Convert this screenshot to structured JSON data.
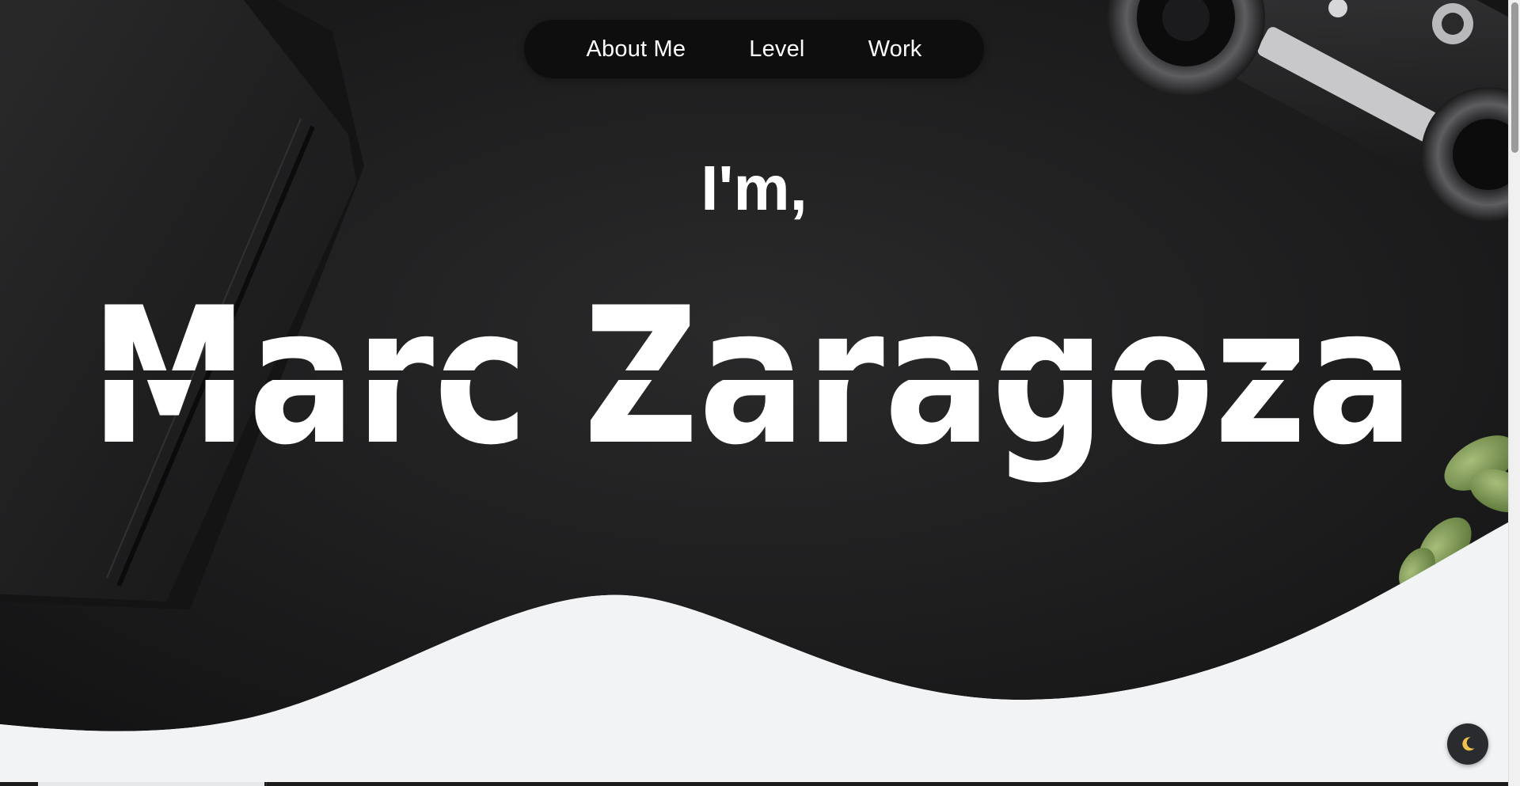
{
  "nav": {
    "items": [
      {
        "label": "About Me"
      },
      {
        "label": "Level"
      },
      {
        "label": "Work"
      }
    ]
  },
  "hero": {
    "intro": "I'm,",
    "name": "Marc Zaragoza"
  },
  "theme_toggle": {
    "icon": "moon-icon"
  },
  "colors": {
    "hero_background": "#1c1c1d",
    "page_background": "#f2f3f5",
    "text": "#ffffff",
    "toggle_background": "#2a2b2e",
    "moon": "#f1c24b"
  }
}
